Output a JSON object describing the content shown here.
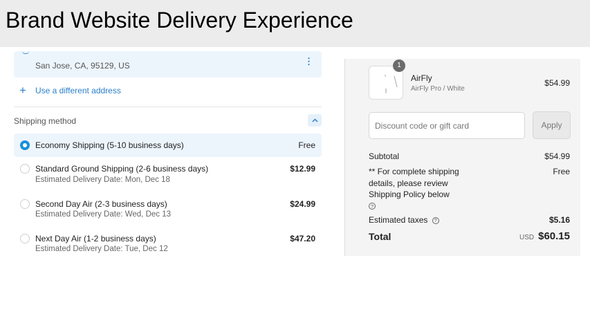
{
  "banner": {
    "title": "Brand Website Delivery Experience"
  },
  "address": {
    "line": "San Jose, CA, 95129, US",
    "use_different": "Use a different address"
  },
  "shipping": {
    "heading": "Shipping method",
    "options": [
      {
        "name": "Economy Shipping (5-10 business days)",
        "date": "",
        "price": "Free",
        "selected": true
      },
      {
        "name": "Standard Ground Shipping (2-6 business days)",
        "date": "Estimated Delivery Date: Mon, Dec 18",
        "price": "$12.99",
        "selected": false
      },
      {
        "name": "Second Day Air (2-3 business days)",
        "date": "Estimated Delivery Date: Wed, Dec 13",
        "price": "$24.99",
        "selected": false
      },
      {
        "name": "Next Day Air (1-2 business days)",
        "date": "Estimated Delivery Date: Tue, Dec 12",
        "price": "$47.20",
        "selected": false
      }
    ]
  },
  "summary": {
    "product": {
      "quantity": "1",
      "name": "AirFly",
      "variant": "AirFly Pro / White",
      "price": "$54.99"
    },
    "discount": {
      "placeholder": "Discount code or gift card",
      "apply_label": "Apply"
    },
    "subtotal_label": "Subtotal",
    "subtotal_value": "$54.99",
    "shipping_note": "** For complete shipping details, please review Shipping Policy below",
    "shipping_value": "Free",
    "help_icon": "?",
    "taxes_label": "Estimated taxes",
    "taxes_value": "$5.16",
    "total_label": "Total",
    "currency": "USD",
    "total_value": "$60.15"
  },
  "colors": {
    "accent": "#1a90d9",
    "link": "#2a7fc8",
    "selected_bg": "#edf5fc",
    "summary_bg": "#f4f4f4"
  },
  "icons": {
    "plus": "plus-icon",
    "menu": "kebab-menu-icon",
    "collapse": "chevron-up-icon",
    "help": "question-circle-icon"
  }
}
